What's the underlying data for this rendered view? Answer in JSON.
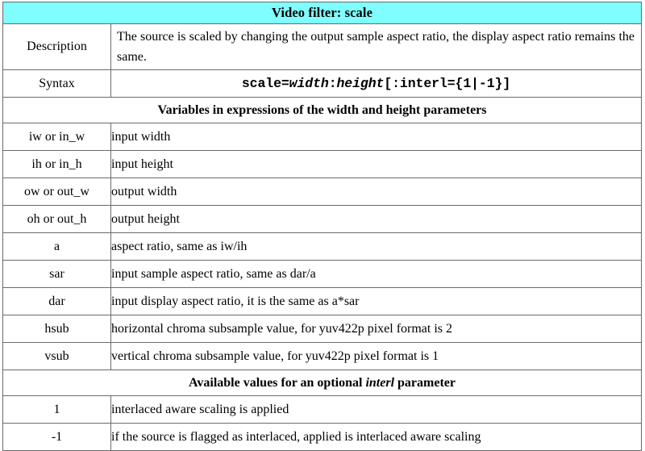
{
  "document": {
    "title": "Video filter: scale",
    "title_bg": "#7ffdff",
    "border_color": "#6b6b6b",
    "text_color": "#000000"
  },
  "rows": {
    "description_label": "Description",
    "description_text": "The source is scaled by changing the output sample aspect ratio, the display aspect ratio remains the same.",
    "syntax_label": "Syntax",
    "syntax": {
      "part1": "scale=",
      "width": "width",
      "colon": ":",
      "height": "height",
      "part2": "[:interl={1|-1}]",
      "full": "scale=width:height[:interl={1|-1}]"
    }
  },
  "variables_section": {
    "header_text": "Variables in expressions of the width and height parameters",
    "items": [
      {
        "name": "iw or in_w",
        "description": "input width"
      },
      {
        "name": "ih or in_h",
        "description": "input height"
      },
      {
        "name": "ow or out_w",
        "description": "output width"
      },
      {
        "name": "oh or out_h",
        "description": "output height"
      },
      {
        "name": "a",
        "description": "aspect ratio, same as iw/ih"
      },
      {
        "name": "sar",
        "description": "input sample aspect ratio, same as dar/a"
      },
      {
        "name": "dar",
        "description": "input display aspect ratio, it is the same as a*sar"
      },
      {
        "name": "hsub",
        "description": "horizontal chroma subsample value, for yuv422p pixel format is 2"
      },
      {
        "name": "vsub",
        "description": "vertical chroma subsample value, for yuv422p pixel format is 1"
      }
    ]
  },
  "interl_section": {
    "header_prefix": "Available values for an optional ",
    "header_italic": "interl",
    "header_suffix": " parameter",
    "items": [
      {
        "name": "1",
        "description": "interlaced aware scaling is applied"
      },
      {
        "name": "-1",
        "description": "if the source is flagged as interlaced, applied is interlaced aware scaling"
      }
    ]
  }
}
